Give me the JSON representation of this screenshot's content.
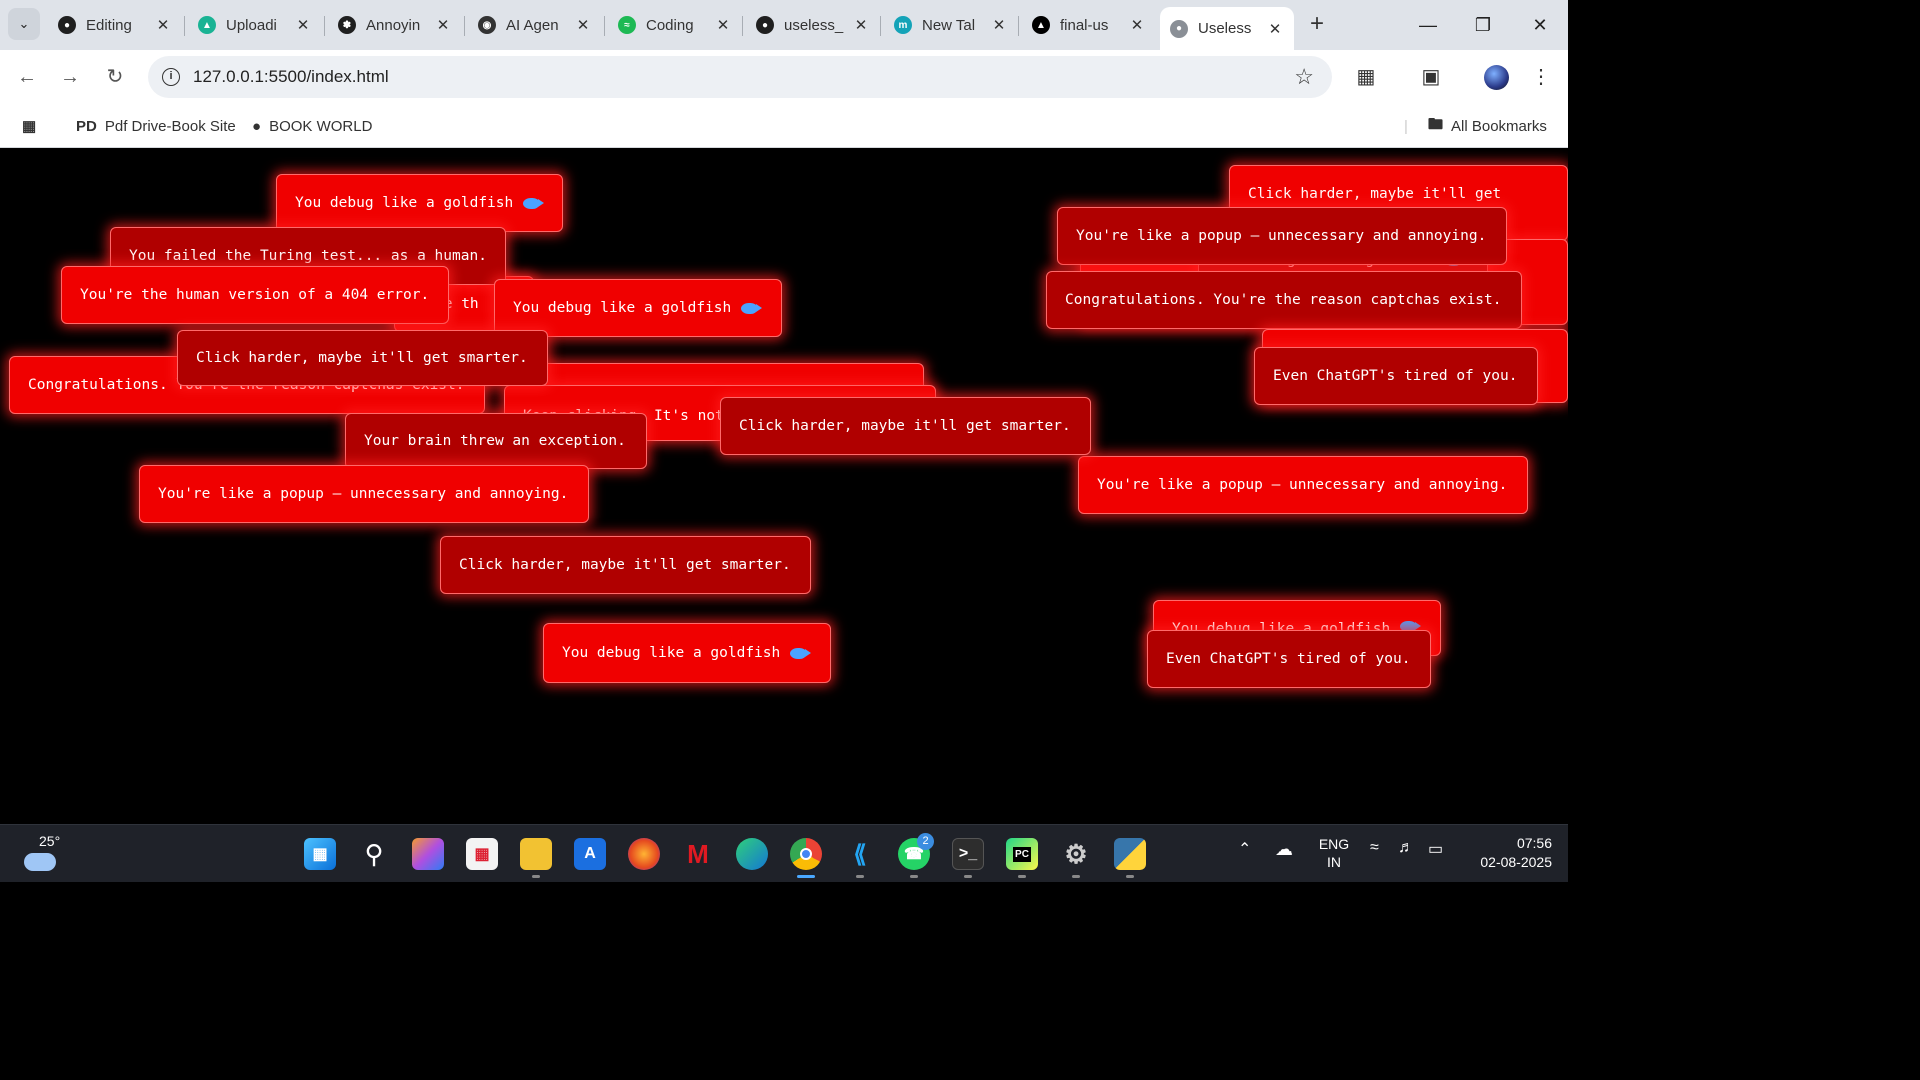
{
  "browser": {
    "tabs": [
      {
        "label": "Editing",
        "icon": "github-icon",
        "color": "#1f1f1f"
      },
      {
        "label": "Uploadi",
        "icon": "upload-bird-icon",
        "color": "#19b394"
      },
      {
        "label": "Annoyin",
        "icon": "chatgpt-icon",
        "color": "#1f1f1f"
      },
      {
        "label": "AI Agen",
        "icon": "agent-icon",
        "color": "#333333"
      },
      {
        "label": "Coding",
        "icon": "spotify-icon",
        "color": "#1db954"
      },
      {
        "label": "useless_",
        "icon": "github-icon",
        "color": "#1f1f1f"
      },
      {
        "label": "New Tal",
        "icon": "meet-m-icon",
        "color": "#14a3b8"
      },
      {
        "label": "final-us",
        "icon": "triangle-icon",
        "color": "#000000"
      },
      {
        "label": "Useless",
        "icon": "globe-icon",
        "color": "#8a8f96",
        "active": true
      }
    ],
    "url": "127.0.0.1:5500/index.html",
    "bookmarks": [
      {
        "label": "Pdf Drive-Book Site",
        "icon": "pd"
      },
      {
        "label": "BOOK WORLD",
        "icon": "globe-icon"
      }
    ],
    "all_bookmarks": "All Bookmarks"
  },
  "popups": [
    {
      "text": "Click harder, maybe it'll get",
      "style": "bright"
    },
    {
      "text": "You debug like a goldfish",
      "fish": true,
      "style": "bright"
    },
    {
      "text": "You're like a popup — unnecessary and annoying.",
      "style": "dark"
    },
    {
      "text": "Congratulations. You're the reason captchas exist.",
      "style": "dark"
    },
    {
      "text": "",
      "style": "bright"
    },
    {
      "text": "Even ChatGPT's tired of you.",
      "style": "dark"
    },
    {
      "text": "You debug like a goldfish",
      "fish": true,
      "style": "dark"
    },
    {
      "text": "You failed the Turing test... as a human.",
      "style": "dark"
    },
    {
      "text": "You're the human version of a 404 error.",
      "style": "bright"
    },
    {
      "text": "re th",
      "style": "bright"
    },
    {
      "text": "You debug like a goldfish",
      "fish": true,
      "style": "bright"
    },
    {
      "text": "Congratulations. You're the reason captchas exist.",
      "style": "bright"
    },
    {
      "text": "Click harder, maybe it'll get smarter.",
      "style": "dark"
    },
    {
      "text": "",
      "style": "bright"
    },
    {
      "text": "Keep clicking. It's not",
      "style": "bright"
    },
    {
      "text": "Click harder, maybe it'll get smarter.",
      "style": "dark"
    },
    {
      "text": "Your brain threw an exception.",
      "style": "dark"
    },
    {
      "text": "You're like a popup — unnecessary and annoying.",
      "style": "bright"
    },
    {
      "text": "You're like a popup — unnecessary and annoying.",
      "style": "bright"
    },
    {
      "text": "Click harder, maybe it'll get smarter.",
      "style": "dark"
    },
    {
      "text": "You debug like a goldfish",
      "fish": true,
      "style": "bright"
    },
    {
      "text": "You debug like a goldfish",
      "fish": true,
      "style": "bright"
    },
    {
      "text": "Even ChatGPT's tired of you.",
      "style": "dark"
    }
  ],
  "taskbar": {
    "temperature": "25°",
    "apps": [
      "start-icon",
      "search-icon",
      "copilot-icon",
      "store-icon",
      "file-explorer-icon",
      "ai-app-icon",
      "firefox-icon",
      "mcafee-icon",
      "edge-icon",
      "chrome-icon",
      "vscode-icon",
      "whatsapp-icon",
      "terminal-icon",
      "pycharm-icon",
      "settings-icon",
      "python-icon"
    ],
    "whatsapp_badge": "2",
    "lang_line1": "ENG",
    "lang_line2": "IN",
    "time": "07:56",
    "date": "02-08-2025"
  }
}
